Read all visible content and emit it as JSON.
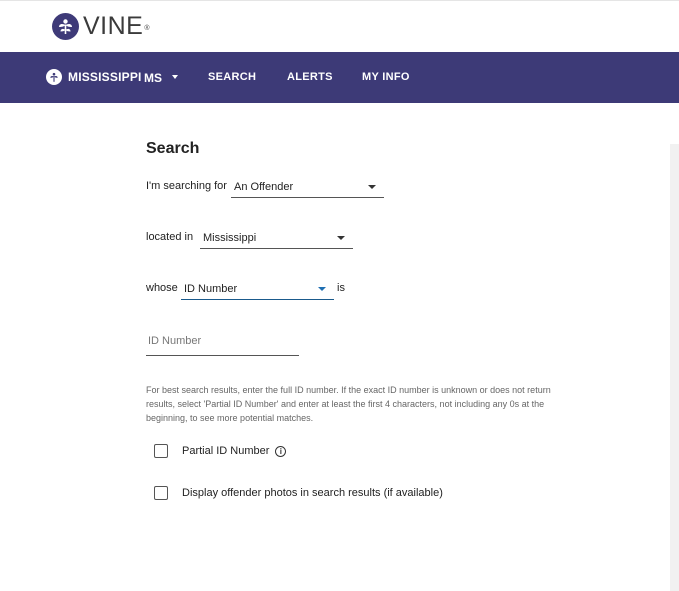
{
  "brand": {
    "name": "VINE",
    "reg_mark": "®"
  },
  "nav": {
    "state_name": "MISSISSIPPI",
    "state_abbr": "MS",
    "links": [
      "SEARCH",
      "ALERTS",
      "MY INFO"
    ]
  },
  "colors": {
    "nav_bg": "#3d3a77",
    "logo": "#3e3a78",
    "focus_underline": "#1a5a8c"
  },
  "form": {
    "title": "Search",
    "searching_for_label": "I'm searching for",
    "searching_for_value": "An Offender",
    "located_in_label": "located in",
    "located_in_value": "Mississippi",
    "whose_label": "whose",
    "whose_value": "ID Number",
    "is_label": "is",
    "id_placeholder": "ID Number",
    "help_text": "For best search results, enter the full ID number. If the exact ID number is unknown or does not return results, select 'Partial ID Number' and enter at least the first 4 characters, not including any 0s at the beginning, to see more potential matches.",
    "partial_id_label": "Partial ID Number",
    "partial_id_info_icon": "i",
    "photos_label": "Display offender photos in search results (if available)"
  },
  "icons": {
    "logo": "vine-leaf-icon",
    "state": "state-seal-icon",
    "info": "info-icon"
  }
}
